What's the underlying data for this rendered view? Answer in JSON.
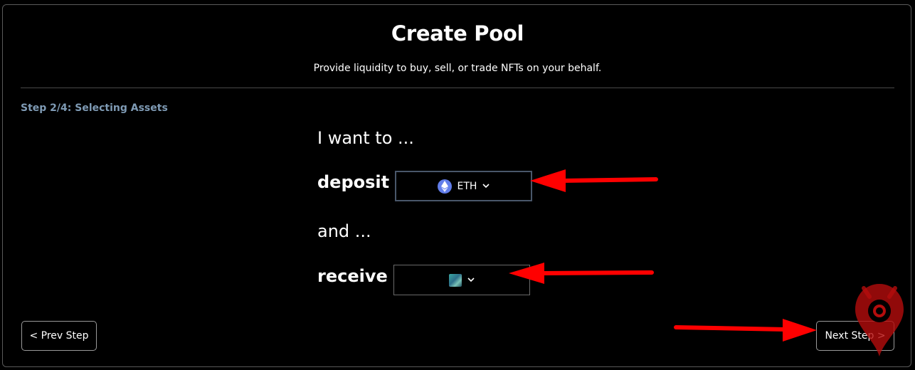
{
  "header": {
    "title": "Create Pool",
    "subtitle": "Provide liquidity to buy, sell, or trade NFTs on your behalf."
  },
  "step": {
    "label": "Step 2/4: Selecting Assets"
  },
  "form": {
    "intro": "I want to ...",
    "deposit_label": "deposit",
    "deposit_token": "ETH",
    "connector": "and ...",
    "receive_label": "receive"
  },
  "nav": {
    "prev_label": "< Prev Step",
    "next_label": "Next Step >"
  },
  "icons": {
    "deposit_token_icon": "ethereum-icon",
    "receive_token_icon": "nft-collection-thumbnail",
    "dropdown_icon": "chevron-down-icon",
    "watermark": "location-pin-eye-logo"
  },
  "colors": {
    "background": "#000000",
    "step_label": "#7f9bb5",
    "eth_blue": "#627eea",
    "annotation_red": "#ff0000"
  }
}
